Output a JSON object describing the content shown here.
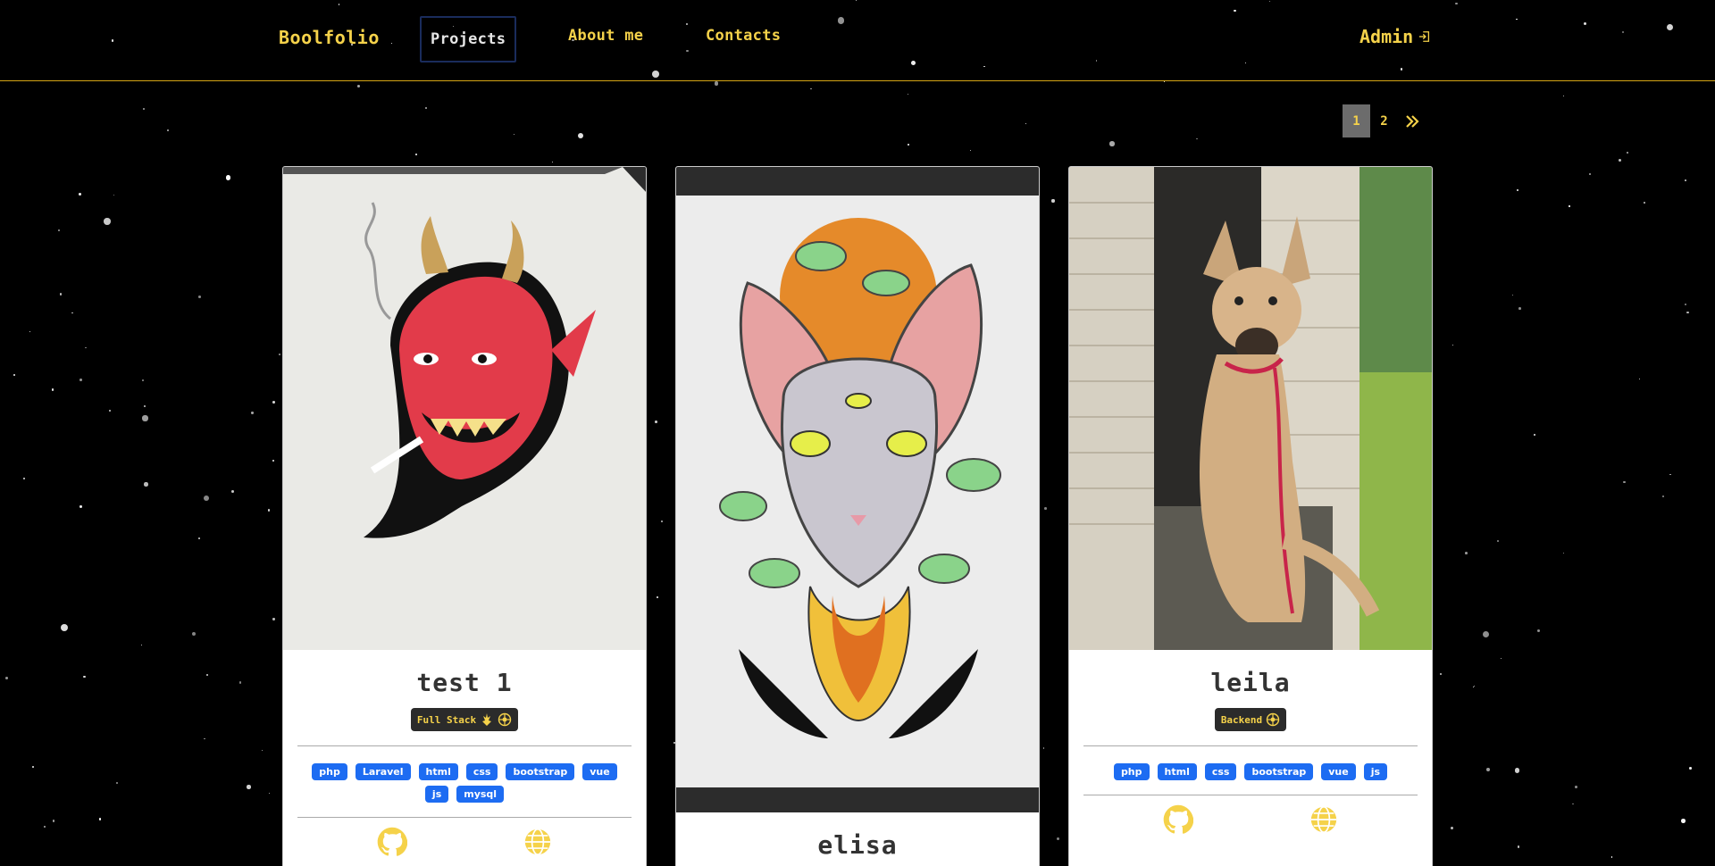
{
  "navbar": {
    "brand": "Boolfolio",
    "links": [
      "Projects",
      "About me",
      "Contacts"
    ],
    "admin_label": "Admin"
  },
  "pagination": {
    "pages": [
      "1",
      "2"
    ],
    "active": "1"
  },
  "colors": {
    "accent": "#f5d24a",
    "tag": "#1d6cf2",
    "badge_bg": "#2b2b2b"
  },
  "projects": [
    {
      "title": "test 1",
      "type": "Full Stack",
      "type_icons": [
        "jedi-icon",
        "galactic-empire-icon"
      ],
      "tags": [
        "php",
        "Laravel",
        "html",
        "css",
        "bootstrap",
        "vue",
        "js",
        "mysql"
      ],
      "image": "red devil face tattoo drawing",
      "links": [
        "github-icon",
        "globe-icon"
      ]
    },
    {
      "title": "elisa",
      "image": "sphynx cat with mushrooms tattoo design"
    },
    {
      "title": "leila",
      "type": "Backend",
      "type_icons": [
        "galactic-empire-icon"
      ],
      "tags": [
        "php",
        "html",
        "css",
        "bootstrap",
        "vue",
        "js"
      ],
      "image": "tan dog sitting on caravan step",
      "links": [
        "github-icon",
        "globe-icon"
      ]
    }
  ]
}
